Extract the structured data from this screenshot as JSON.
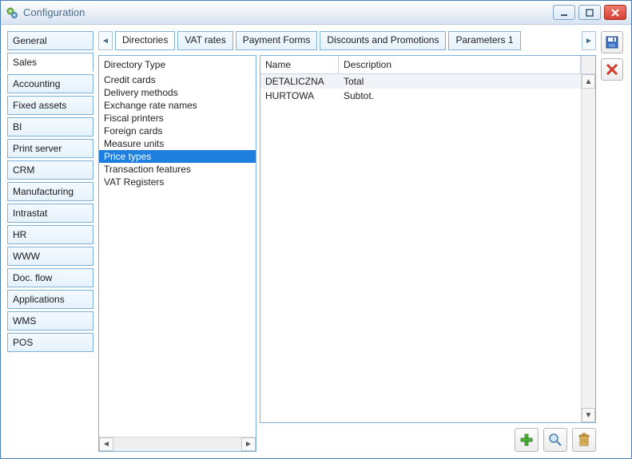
{
  "window": {
    "title": "Configuration"
  },
  "sidebar": {
    "items": [
      {
        "label": "General"
      },
      {
        "label": "Sales"
      },
      {
        "label": "Accounting"
      },
      {
        "label": "Fixed assets"
      },
      {
        "label": "BI"
      },
      {
        "label": "Print server"
      },
      {
        "label": "CRM"
      },
      {
        "label": "Manufacturing"
      },
      {
        "label": "Intrastat"
      },
      {
        "label": "HR"
      },
      {
        "label": "WWW"
      },
      {
        "label": "Doc. flow"
      },
      {
        "label": "Applications"
      },
      {
        "label": "WMS"
      },
      {
        "label": "POS"
      }
    ],
    "active_index": 1
  },
  "tabs": {
    "items": [
      {
        "label": "Directories"
      },
      {
        "label": "VAT rates"
      },
      {
        "label": "Payment Forms"
      },
      {
        "label": "Discounts and Promotions"
      },
      {
        "label": "Parameters 1"
      }
    ],
    "active_index": 0
  },
  "directory_panel": {
    "header": "Directory Type",
    "items": [
      "Credit cards",
      "Delivery methods",
      "Exchange rate names",
      "Fiscal printers",
      "Foreign cards",
      "Measure units",
      "Price types",
      "Transaction features",
      "VAT Registers"
    ],
    "selected_index": 6
  },
  "table": {
    "columns": {
      "name": "Name",
      "description": "Description"
    },
    "rows": [
      {
        "name": "DETALICZNA",
        "description": "Total"
      },
      {
        "name": "HURTOWA",
        "description": "Subtot."
      }
    ]
  },
  "icons": {
    "app": "gear-icon",
    "minimize": "minimize-icon",
    "maximize": "maximize-icon",
    "close": "close-icon",
    "save": "save-icon",
    "delete_right": "delete-x-icon",
    "add": "plus-icon",
    "search": "magnifier-icon",
    "trash": "trash-icon",
    "scroll_left": "chevron-left-icon",
    "scroll_right": "chevron-right-icon",
    "scroll_up": "chevron-up-icon",
    "scroll_down": "chevron-down-icon"
  }
}
